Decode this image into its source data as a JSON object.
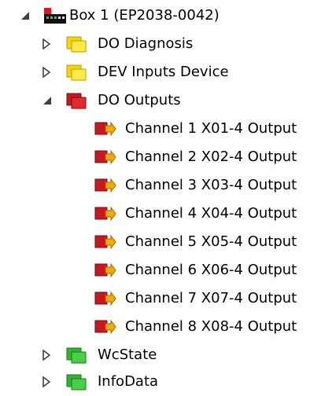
{
  "tree": {
    "box": {
      "label": "Box 1 (EP2038-0042)",
      "expanded": true,
      "icon": "ethercat-box-icon"
    },
    "items": [
      {
        "label": "DO Diagnosis",
        "expanded": false,
        "icon": "folder-yellow-icon"
      },
      {
        "label": "DEV Inputs Device",
        "expanded": false,
        "icon": "folder-yellow-icon"
      },
      {
        "label": "DO Outputs",
        "expanded": true,
        "icon": "folder-red-icon",
        "children": [
          "Channel 1 X01-4 Output",
          "Channel 2 X02-4 Output",
          "Channel 3 X03-4 Output",
          "Channel 4 X04-4 Output",
          "Channel 5 X05-4 Output",
          "Channel 6 X06-4 Output",
          "Channel 7 X07-4 Output",
          "Channel 8 X08-4 Output"
        ]
      },
      {
        "label": "WcState",
        "expanded": false,
        "icon": "folder-green-icon"
      },
      {
        "label": "InfoData",
        "expanded": false,
        "icon": "folder-green-icon"
      }
    ]
  },
  "colors": {
    "yellow_folder": "#f7d600",
    "red_folder": "#c8171e",
    "green_folder": "#2fb52f",
    "output_arrow": "#f2a900"
  }
}
